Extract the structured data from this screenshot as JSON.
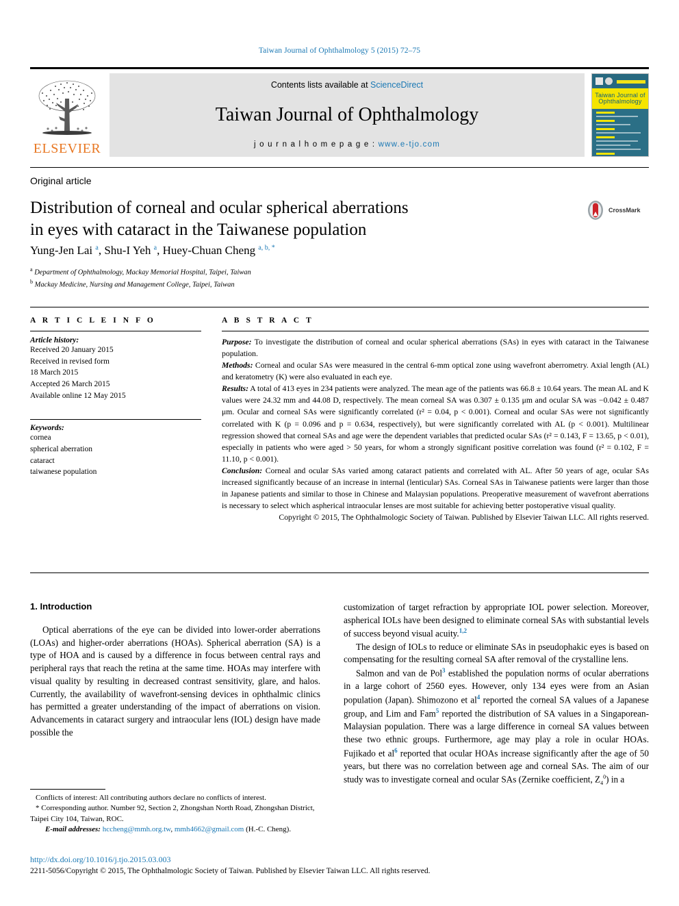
{
  "running_head": "Taiwan Journal of Ophthalmology 5 (2015) 72–75",
  "masthead": {
    "publisher_name": "ELSEVIER",
    "contents_prefix": "Contents lists available at ",
    "sciencedirect": "ScienceDirect",
    "journal_title": "Taiwan Journal of Ophthalmology",
    "homepage_prefix": "j o u r n a l   h o m e p a g e :   ",
    "homepage_url": "www.e-tjo.com",
    "cover_title_line1": "Taiwan Journal of",
    "cover_title_line2": "Ophthalmology"
  },
  "article": {
    "kicker": "Original article",
    "title_line1": "Distribution of corneal and ocular spherical aberrations",
    "title_line2": "in eyes with cataract in the Taiwanese population",
    "crossmark_label": "CrossMark",
    "authors": "Yung-Jen Lai , Shu-I Yeh , Huey-Chuan Cheng",
    "author_marks": [
      "a",
      "a",
      "a, b, *"
    ],
    "affiliation_a": "Department of Ophthalmology, Mackay Memorial Hospital, Taipei, Taiwan",
    "affiliation_b": "Mackay Medicine, Nursing and Management College, Taipei, Taiwan"
  },
  "article_info": {
    "heading": "A R T I C L E   I N F O",
    "history_label": "Article history:",
    "history": [
      "Received 20 January 2015",
      "Received in revised form",
      "18 March 2015",
      "Accepted 26 March 2015",
      "Available online 12 May 2015"
    ],
    "keywords_label": "Keywords:",
    "keywords": [
      "cornea",
      "spherical aberration",
      "cataract",
      "taiwanese population"
    ]
  },
  "abstract": {
    "heading": "A B S T R A C T",
    "purpose_label": "Purpose:",
    "purpose_text": " To investigate the distribution of corneal and ocular spherical aberrations (SAs) in eyes with cataract in the Taiwanese population.",
    "methods_label": "Methods:",
    "methods_text": " Corneal and ocular SAs were measured in the central 6-mm optical zone using wavefront aberrometry. Axial length (AL) and keratometry (K) were also evaluated in each eye.",
    "results_label": "Results:",
    "results_text": " A total of 413 eyes in 234 patients were analyzed. The mean age of the patients was 66.8 ± 10.64 years. The mean AL and K values were 24.32 mm and 44.08 D, respectively. The mean corneal SA was 0.307 ± 0.135 μm and ocular SA was −0.042 ± 0.487 μm. Ocular and corneal SAs were significantly correlated (r² = 0.04, p < 0.001). Corneal and ocular SAs were not significantly correlated with K (p = 0.096 and p = 0.634, respectively), but were significantly correlated with AL (p < 0.001). Multilinear regression showed that corneal SAs and age were the dependent variables that predicted ocular SAs (r² = 0.143, F = 13.65, p < 0.01), especially in patients who were aged > 50 years, for whom a strongly significant positive correlation was found (r² = 0.102, F = 11.10, p < 0.001).",
    "conclusion_label": "Conclusion:",
    "conclusion_text": "  Corneal and ocular SAs varied among cataract patients and correlated with AL. After 50 years of age, ocular SAs increased significantly because of an increase in internal (lenticular) SAs. Corneal SAs in Taiwanese patients were larger than those in Japanese patients and similar to those in Chinese and Malaysian populations. Preoperative measurement of wavefront aberrations is necessary to select which aspherical intraocular lenses are most suitable for achieving better postoperative visual quality.",
    "copyright": "Copyright © 2015, The Ophthalmologic Society of Taiwan. Published by Elsevier Taiwan LLC. All rights reserved."
  },
  "body": {
    "intro_heading": "1.  Introduction",
    "left_p1": "Optical aberrations of the eye can be divided into lower-order aberrations (LOAs) and higher-order aberrations (HOAs). Spherical aberration (SA) is a type of HOA and is caused by a difference in focus between central rays and peripheral rays that reach the retina at the same time. HOAs may interfere with visual quality by resulting in decreased contrast sensitivity, glare, and halos. Currently, the availability of wavefront-sensing devices in ophthalmic clinics has permitted a greater understanding of the impact of aberrations on vision. Advancements in cataract surgery and intraocular lens (IOL) design have made possible the",
    "right_p1_a": "customization of target refraction by appropriate IOL power selection. Moreover, aspherical IOLs have been designed to eliminate corneal SAs with substantial levels of success beyond visual acuity.",
    "right_p1_ref": "1,2",
    "right_p2": "The design of IOLs to reduce or eliminate SAs in pseudophakic eyes is based on compensating for the resulting corneal SA after removal of the crystalline lens.",
    "right_p3_a": "Salmon and van de Pol",
    "right_p3_ref1": "3",
    "right_p3_b": " established the population norms of ocular aberrations in a large cohort of 2560 eyes. However, only 134 eyes were from an Asian population (Japan). Shimozono et al",
    "right_p3_ref2": "4",
    "right_p3_c": " reported the corneal SA values of a Japanese group, and Lim and Fam",
    "right_p3_ref3": "5",
    "right_p3_d": " reported the distribution of SA values in a Singaporean-Malaysian population. There was a large difference in corneal SA values between these two ethnic groups. Furthermore, age may play a role in ocular HOAs. Fujikado et al",
    "right_p3_ref4": "6",
    "right_p3_e": " reported that ocular HOAs increase significantly after the age of 50 years, but there was no correlation between age and corneal SAs. The aim of our study was to investigate corneal and ocular SAs (Zernike coefficient, Z",
    "right_p3_zsub": "4",
    "right_p3_zsup": "0",
    "right_p3_f": ") in a"
  },
  "footnotes": {
    "conflicts": "Conflicts of interest: All contributing authors declare no conflicts of interest.",
    "corresponding_mark": "*",
    "corresponding": " Corresponding author. Number 92, Section 2, Zhongshan North Road, Zhongshan District, Taipei City 104, Taiwan, ROC.",
    "email_label": "E-mail addresses:",
    "email1": "hccheng@mmh.org.tw",
    "email_sep": ", ",
    "email2": "mmh4662@gmail.com",
    "email_suffix": " (H.-C. Cheng).",
    "doi": "http://dx.doi.org/10.1016/j.tjo.2015.03.003",
    "issn_copyright": "2211-5056/Copyright © 2015, The Ophthalmologic Society of Taiwan. Published by Elsevier Taiwan LLC. All rights reserved."
  },
  "colors": {
    "link_blue": "#1a78b4",
    "elsevier_orange": "#E87722",
    "band_gray": "#e3e3e3",
    "cover_teal": "#2b6f86",
    "cover_yellow": "#f5e500",
    "crossmark_red": "#cc2229"
  }
}
